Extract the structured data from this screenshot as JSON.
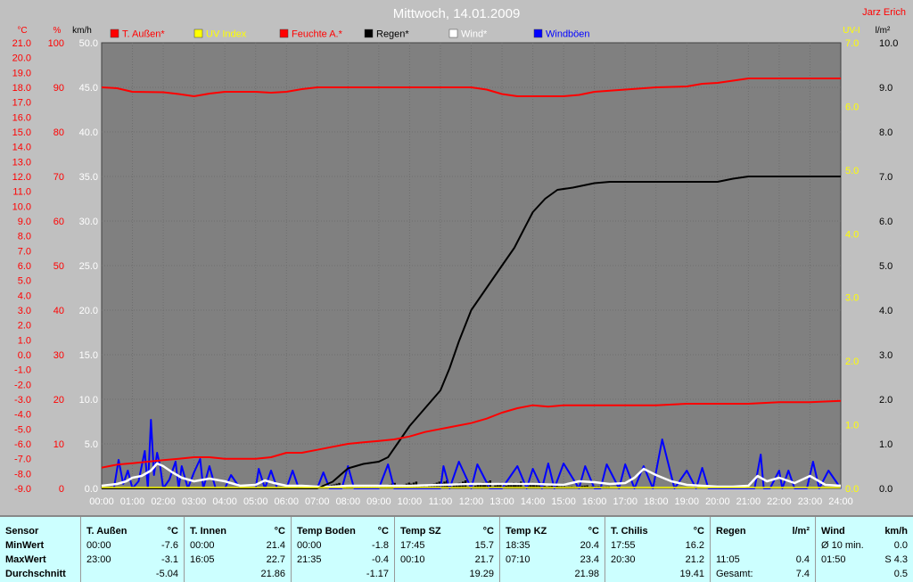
{
  "header": {
    "title": "Mittwoch, 14.01.2009",
    "author": "Jarz Erich"
  },
  "legend": [
    {
      "label": "T. Außen*",
      "color": "#ff0000"
    },
    {
      "label": "UV Index",
      "color": "#ffff00"
    },
    {
      "label": "Feuchte A.*",
      "color": "#ff0000"
    },
    {
      "label": "Regen*",
      "color": "#000000"
    },
    {
      "label": "Wind*",
      "color": "#ffffff"
    },
    {
      "label": "Windböen",
      "color": "#0000ff"
    }
  ],
  "axes": {
    "temp_unit": "°C",
    "hum_unit": "%",
    "wind_unit": "km/h",
    "uv_unit": "UV-I",
    "rain_unit": "l/m²"
  },
  "chart_data": {
    "type": "line",
    "x_range_hours": [
      0,
      24
    ],
    "x_tick_labels": [
      "00:00",
      "01:00",
      "02:00",
      "03:00",
      "04:00",
      "05:00",
      "06:00",
      "07:00",
      "08:00",
      "09:00",
      "10:00",
      "11:00",
      "12:00",
      "13:00",
      "14:00",
      "15:00",
      "16:00",
      "17:00",
      "18:00",
      "19:00",
      "20:00",
      "21:00",
      "22:00",
      "23:00",
      "24:00"
    ],
    "temp_axis": {
      "range": [
        -9,
        21
      ],
      "ticks": [
        "21.0",
        "20.0",
        "19.0",
        "18.0",
        "17.0",
        "16.0",
        "15.0",
        "14.0",
        "13.0",
        "12.0",
        "11.0",
        "10.0",
        "9.0",
        "8.0",
        "7.0",
        "6.0",
        "5.0",
        "4.0",
        "3.0",
        "2.0",
        "1.0",
        "0.0",
        "-1.0",
        "-2.0",
        "-3.0",
        "-4.0",
        "-5.0",
        "-6.0",
        "-7.0",
        "-8.0",
        "-9.0"
      ]
    },
    "humidity_axis": {
      "range": [
        0,
        100
      ],
      "ticks": [
        "100",
        "90",
        "80",
        "70",
        "60",
        "50",
        "40",
        "30",
        "20",
        "10",
        "0"
      ]
    },
    "wind_axis": {
      "range": [
        0,
        50
      ],
      "ticks": [
        "50.0",
        "45.0",
        "40.0",
        "35.0",
        "30.0",
        "25.0",
        "20.0",
        "15.0",
        "10.0",
        "5.0",
        "0.0"
      ]
    },
    "uv_axis": {
      "range": [
        0,
        7
      ],
      "ticks": [
        "7.0",
        "6.0",
        "5.0",
        "4.0",
        "3.0",
        "2.0",
        "1.0",
        "0.0"
      ]
    },
    "rain_axis": {
      "range": [
        0,
        10
      ],
      "ticks": [
        "10.0",
        "9.0",
        "8.0",
        "7.0",
        "6.0",
        "5.0",
        "4.0",
        "3.0",
        "2.0",
        "1.0",
        "0.0"
      ]
    },
    "series": [
      {
        "name": "T. Außen*",
        "axis": "temp",
        "color": "#ff0000",
        "x": [
          0,
          0.5,
          1,
          1.5,
          2,
          2.5,
          3,
          3.5,
          4,
          4.5,
          5,
          5.5,
          6,
          6.5,
          7,
          7.5,
          8,
          8.5,
          9,
          9.5,
          10,
          10.5,
          11,
          11.5,
          12,
          12.5,
          13,
          13.5,
          14,
          14.5,
          15,
          15.5,
          16,
          17,
          18,
          19,
          20,
          21,
          22,
          23,
          24
        ],
        "values": [
          -7.6,
          -7.4,
          -7.3,
          -7.2,
          -7.1,
          -7.0,
          -6.9,
          -6.9,
          -7.0,
          -7.0,
          -7.0,
          -6.9,
          -6.6,
          -6.6,
          -6.4,
          -6.2,
          -6.0,
          -5.9,
          -5.8,
          -5.7,
          -5.5,
          -5.2,
          -5.0,
          -4.8,
          -4.6,
          -4.3,
          -3.9,
          -3.6,
          -3.4,
          -3.5,
          -3.4,
          -3.4,
          -3.4,
          -3.4,
          -3.4,
          -3.3,
          -3.3,
          -3.3,
          -3.2,
          -3.2,
          -3.1
        ]
      },
      {
        "name": "Feuchte A.*",
        "axis": "humidity",
        "color": "#ff0000",
        "x": [
          0,
          0.5,
          1,
          2,
          2.5,
          3,
          3.5,
          4,
          5,
          5.5,
          6,
          6.5,
          7,
          8,
          9,
          10,
          11,
          12,
          12.5,
          13,
          13.5,
          14,
          15,
          15.5,
          16,
          17,
          18,
          19,
          19.5,
          20,
          21,
          22,
          23,
          24
        ],
        "values": [
          90,
          89.8,
          89,
          88.9,
          88.5,
          88,
          88.6,
          89,
          89,
          88.8,
          89,
          89.6,
          90,
          90,
          90,
          90,
          90,
          90,
          89.5,
          88.5,
          88,
          88,
          88,
          88.3,
          89,
          89.5,
          90,
          90.2,
          90.8,
          91,
          92,
          92,
          92,
          92
        ]
      },
      {
        "name": "Regen*",
        "axis": "rain",
        "color": "#000000",
        "x": [
          0,
          7,
          7.5,
          8,
          8.5,
          9,
          9.3,
          9.6,
          10,
          10.5,
          11,
          11.3,
          11.6,
          12,
          12.4,
          13,
          13.4,
          13.7,
          14,
          14.4,
          14.8,
          15.3,
          16,
          16.5,
          17,
          18,
          19,
          19.5,
          20,
          20.5,
          21,
          22,
          23,
          24
        ],
        "values": [
          0,
          0,
          0.15,
          0.45,
          0.55,
          0.6,
          0.7,
          1.0,
          1.4,
          1.8,
          2.2,
          2.7,
          3.3,
          4.0,
          4.4,
          5.0,
          5.4,
          5.8,
          6.2,
          6.5,
          6.7,
          6.75,
          6.85,
          6.88,
          6.88,
          6.88,
          6.88,
          6.88,
          6.88,
          6.95,
          7.0,
          7.0,
          7.0,
          7.0
        ]
      },
      {
        "name": "Wind*",
        "axis": "wind",
        "color": "#ffffff",
        "x": [
          0,
          0.5,
          0.8,
          1,
          1.3,
          1.6,
          1.8,
          2.0,
          2.3,
          2.6,
          3.0,
          3.5,
          4,
          4.5,
          5,
          5.3,
          5.6,
          6,
          6.5,
          7,
          7.5,
          8,
          9,
          10,
          11,
          12,
          13,
          14,
          15,
          15.5,
          16,
          16.5,
          17,
          17.3,
          17.6,
          18,
          18.5,
          19,
          20,
          20.5,
          21,
          21.3,
          21.6,
          22,
          22.5,
          23,
          23.5,
          24
        ],
        "values": [
          0.3,
          0.5,
          0.8,
          1.2,
          1.4,
          2.0,
          2.8,
          2.5,
          1.8,
          1.2,
          0.8,
          1.1,
          0.8,
          0.3,
          0.4,
          0.9,
          0.6,
          0.3,
          0.3,
          0.2,
          0.2,
          0.3,
          0.3,
          0.3,
          0.4,
          0.5,
          0.5,
          0.5,
          0.4,
          0.8,
          0.7,
          0.5,
          0.6,
          1.2,
          2.2,
          1.5,
          0.8,
          0.4,
          0.2,
          0.2,
          0.3,
          1.4,
          0.8,
          1.2,
          0.6,
          1.4,
          0.4,
          0.3
        ]
      },
      {
        "name": "Windböen",
        "axis": "wind",
        "color": "#0000ff",
        "x": [
          0,
          0.4,
          0.55,
          0.7,
          0.85,
          1.0,
          1.2,
          1.4,
          1.5,
          1.6,
          1.7,
          1.8,
          1.9,
          2.0,
          2.2,
          2.4,
          2.5,
          2.6,
          2.8,
          3.0,
          3.2,
          3.3,
          3.5,
          3.7,
          4.0,
          4.2,
          4.5,
          5.0,
          5.1,
          5.3,
          5.5,
          5.7,
          6.0,
          6.2,
          6.4,
          7.0,
          7.2,
          7.4,
          7.8,
          8.0,
          8.2,
          8.5,
          9.0,
          9.3,
          9.5,
          9.7,
          10.0,
          10.5,
          11.0,
          11.1,
          11.3,
          11.6,
          12.0,
          12.2,
          12.6,
          13.0,
          13.5,
          13.8,
          14.0,
          14.3,
          14.5,
          14.7,
          15.0,
          15.5,
          15.7,
          16.0,
          16.2,
          16.4,
          16.8,
          17.0,
          17.3,
          17.6,
          17.9,
          18.2,
          18.6,
          19.0,
          19.3,
          19.5,
          19.7,
          20.0,
          20.5,
          21.0,
          21.2,
          21.4,
          21.5,
          21.7,
          22.0,
          22.1,
          22.3,
          22.5,
          22.9,
          23.1,
          23.3,
          23.6,
          24.0
        ],
        "values": [
          0,
          0,
          3.2,
          0.5,
          2.0,
          0,
          0.8,
          4.2,
          0,
          7.7,
          1.5,
          4.0,
          2.5,
          0,
          1.0,
          3.0,
          0,
          2.5,
          0,
          1.8,
          3.3,
          0,
          2.5,
          0,
          0,
          1.5,
          0,
          0,
          2.2,
          0,
          2.0,
          0,
          0,
          2.0,
          0,
          0,
          1.8,
          0,
          0,
          2.5,
          0,
          0,
          0,
          2.7,
          0,
          0,
          0,
          0,
          0,
          2.5,
          0,
          3.0,
          0,
          2.7,
          0,
          0,
          2.5,
          0,
          2.2,
          0,
          2.8,
          0,
          2.8,
          0,
          2.5,
          0,
          0,
          2.7,
          0,
          2.7,
          0,
          2.5,
          0,
          5.5,
          0,
          2.0,
          0,
          2.3,
          0,
          0,
          0,
          0,
          0,
          3.8,
          0,
          0,
          2.0,
          0,
          2.0,
          0,
          0,
          3.0,
          0,
          2.0,
          0
        ]
      }
    ]
  },
  "stats": {
    "sensor_col": {
      "header": "Sensor",
      "rows": [
        "MinWert",
        "MaxWert",
        "Durchschnitt"
      ]
    },
    "columns": [
      {
        "name": "T. Außen",
        "unit": "°C",
        "min_time": "00:00",
        "min_value": "-7.6",
        "max_time": "23:00",
        "max_value": "-3.1",
        "avg": "-5.04"
      },
      {
        "name": "T. Innen",
        "unit": "°C",
        "min_time": "00:00",
        "min_value": "21.4",
        "max_time": "16:05",
        "max_value": "22.7",
        "avg": "21.86"
      },
      {
        "name": "Temp Boden",
        "unit": "°C",
        "min_time": "00:00",
        "min_value": "-1.8",
        "max_time": "21:35",
        "max_value": "-0.4",
        "avg": "-1.17"
      },
      {
        "name": "Temp SZ",
        "unit": "°C",
        "min_time": "17:45",
        "min_value": "15.7",
        "max_time": "00:10",
        "max_value": "21.7",
        "avg": "19.29"
      },
      {
        "name": "Temp KZ",
        "unit": "°C",
        "min_time": "18:35",
        "min_value": "20.4",
        "max_time": "07:10",
        "max_value": "23.4",
        "avg": "21.98"
      },
      {
        "name": "T. Chilis",
        "unit": "°C",
        "min_time": "17:55",
        "min_value": "16.2",
        "max_time": "20:30",
        "max_value": "21.2",
        "avg": "19.41"
      }
    ],
    "regen": {
      "name": "Regen",
      "unit": "l/m²",
      "r1_value": "",
      "r2_time": "11:05",
      "r2_value": "0.4",
      "r3_label": "Gesamt:",
      "r3_value": "7.4"
    },
    "wind": {
      "name": "Wind",
      "unit": "km/h",
      "r1_label": "Ø 10 min.",
      "r1_value": "0.0",
      "r2_time": "01:50",
      "r2_value": "S 4.3",
      "r3_value": "0.5"
    }
  }
}
